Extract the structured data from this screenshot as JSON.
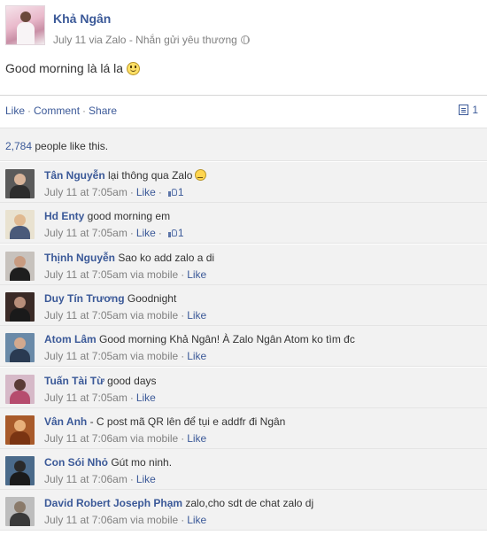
{
  "post": {
    "author": "Khả Ngân",
    "meta": "July 11 via Zalo - Nhắn gửi yêu thương",
    "text": "Good morning là lá la",
    "emoji_icon": "smiley-icon",
    "audience_icon": "globe-icon"
  },
  "actions": {
    "like": "Like",
    "comment": "Comment",
    "share": "Share",
    "share_count": "1"
  },
  "likes": {
    "count": "2,784",
    "text": " people like this."
  },
  "comments": [
    {
      "name": "Tân Nguyễn",
      "text": " lại thông qua Zalo",
      "date": "July 11 at 7:05am",
      "via": "",
      "like": "Like",
      "likes": "1",
      "emoji": true
    },
    {
      "name": "Hd Enty",
      "text": " good morning em",
      "date": "July 11 at 7:05am",
      "via": "",
      "like": "Like",
      "likes": "1",
      "emoji": false
    },
    {
      "name": "Thịnh Nguyễn",
      "text": " Sao ko add zalo a di",
      "date": "July 11 at 7:05am",
      "via": " via mobile",
      "like": "Like",
      "likes": "",
      "emoji": false
    },
    {
      "name": "Duy Tín Trương",
      "text": " Goodnight",
      "date": "July 11 at 7:05am",
      "via": " via mobile",
      "like": "Like",
      "likes": "",
      "emoji": false
    },
    {
      "name": "Atom Lâm",
      "text": " Good morning Khả Ngân! À Zalo Ngân Atom ko tìm đc",
      "date": "July 11 at 7:05am",
      "via": " via mobile",
      "like": "Like",
      "likes": "",
      "emoji": false
    },
    {
      "name": "Tuấn Tài Từ",
      "text": " good days",
      "date": "July 11 at 7:05am",
      "via": "",
      "like": "Like",
      "likes": "",
      "emoji": false
    },
    {
      "name": "Vân Anh",
      "text": " - C post mã QR lên để tụi e addfr đi Ngân",
      "date": "July 11 at 7:06am",
      "via": " via mobile",
      "like": "Like",
      "likes": "",
      "emoji": false
    },
    {
      "name": "Con Sói Nhỏ",
      "text": " Gút mo ninh.",
      "date": "July 11 at 7:06am",
      "via": "",
      "like": "Like",
      "likes": "",
      "emoji": false
    },
    {
      "name": "David Robert Joseph Phạm",
      "text": " zalo,cho sdt de chat zalo dj",
      "date": "July 11 at 7:06am",
      "via": " via mobile",
      "like": "Like",
      "likes": "",
      "emoji": false
    }
  ],
  "colors": {
    "link": "#3b5998",
    "meta": "#808080",
    "comment_bg": "#f2f2f2"
  }
}
